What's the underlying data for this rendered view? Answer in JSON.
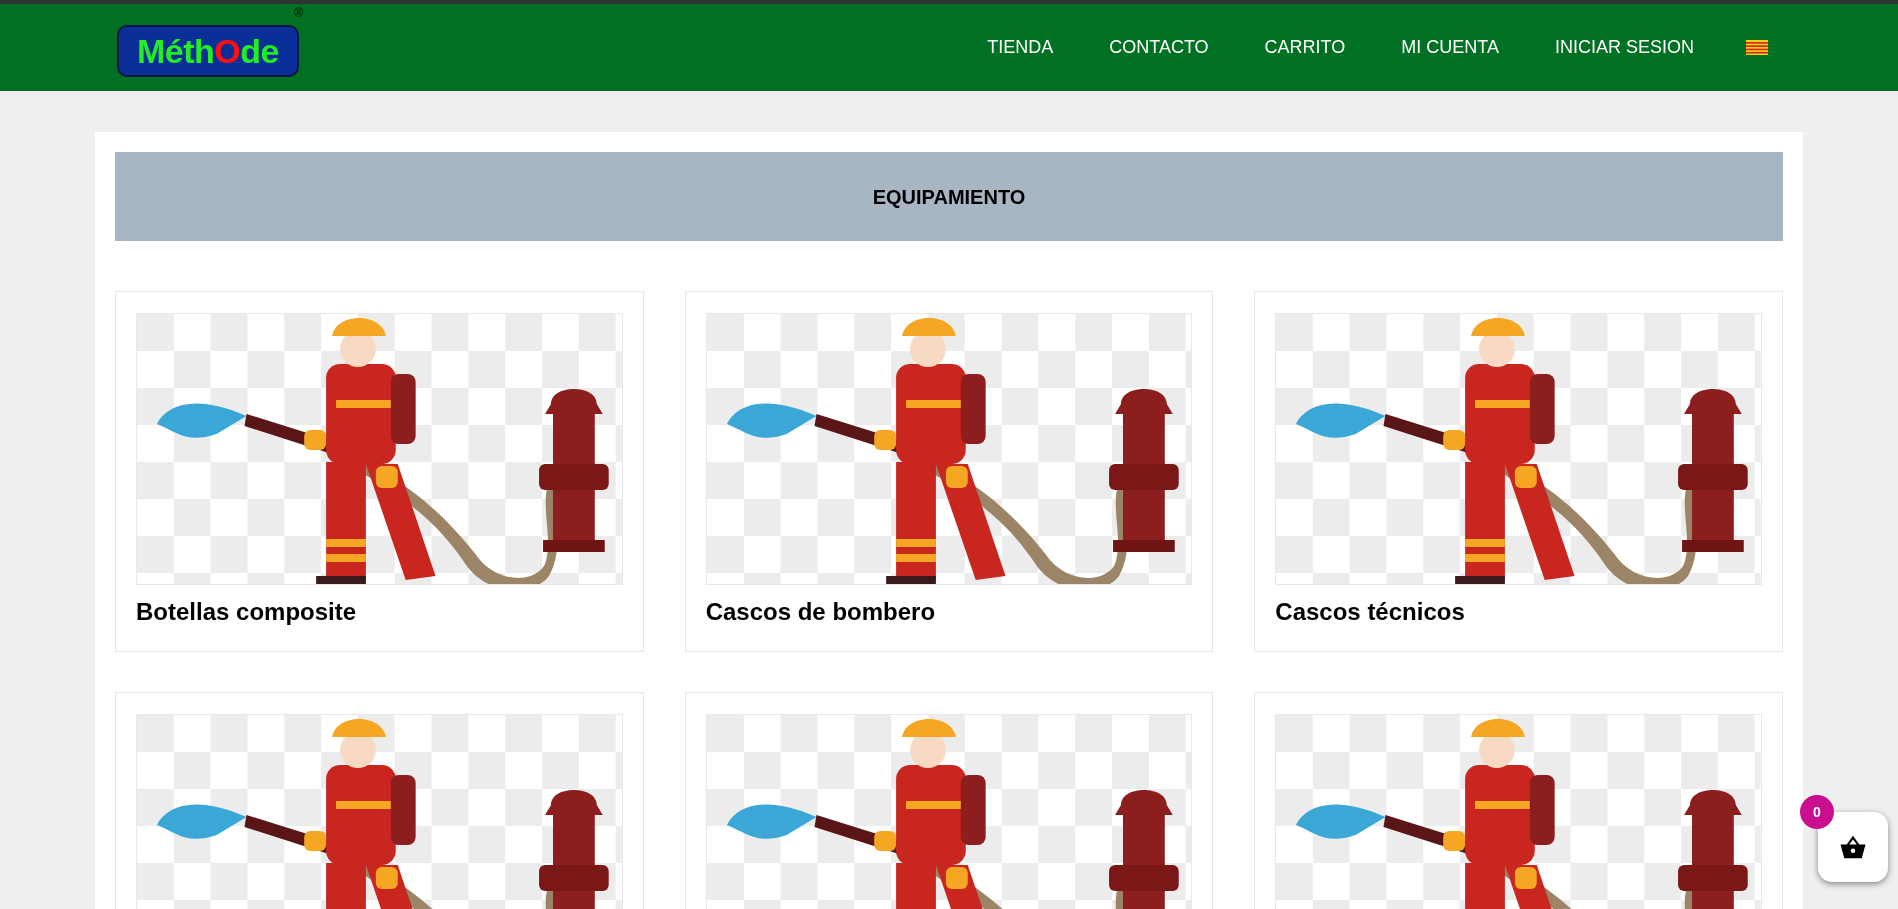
{
  "header": {
    "logo": {
      "parts": [
        {
          "text": "Méth",
          "color": "#22ee22"
        },
        {
          "text": "O",
          "color": "#ff1010"
        },
        {
          "text": "de",
          "color": "#22ee22"
        }
      ],
      "mark": "®"
    },
    "nav": [
      {
        "label": "TIENDA"
      },
      {
        "label": "CONTACTO"
      },
      {
        "label": "CARRITO"
      },
      {
        "label": "MI CUENTA"
      },
      {
        "label": "INICIAR SESION"
      }
    ]
  },
  "category": {
    "title": "EQUIPAMIENTO"
  },
  "products": [
    {
      "kind": "full",
      "title": "Botellas composite"
    },
    {
      "kind": "full",
      "title": "Cascos de bombero"
    },
    {
      "kind": "full",
      "title": "Cascos técnicos"
    },
    {
      "kind": "cut"
    },
    {
      "kind": "cut"
    },
    {
      "kind": "cut"
    }
  ],
  "cart": {
    "count": "0"
  }
}
